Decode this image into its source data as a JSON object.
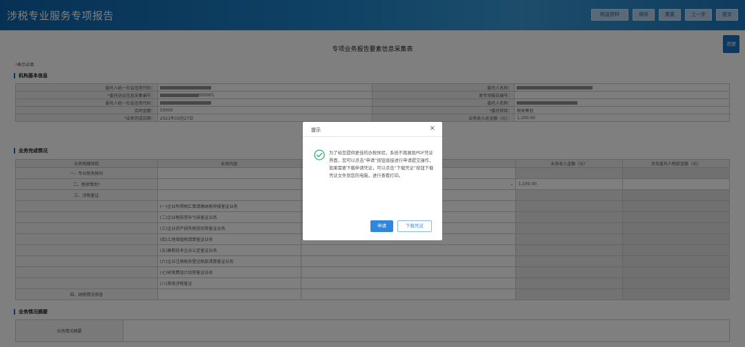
{
  "header": {
    "title": "涉税专业服务专项报告",
    "buttons": [
      "附送资料",
      "保存",
      "重置",
      "上一步",
      "提交"
    ]
  },
  "form": {
    "title": "专项业务报告要素信息采集表",
    "progress_label": "进度",
    "required_note_star": "*",
    "required_note": "表示必填"
  },
  "basic_section": {
    "title": "机构基本信息",
    "rows": [
      {
        "left_label": "委托人统一社会信用代码：",
        "left_value": "",
        "right_label": "委托人名称：",
        "right_value": ""
      },
      {
        "left_label": "委托协议信息采集编号：",
        "left_value": "000001",
        "right_label": "原专项报告编号：",
        "right_value": ""
      },
      {
        "left_label": "委托人统一社会信用代码：",
        "left_value": "",
        "right_label": "委托人名称：",
        "right_value": ""
      },
      {
        "left_label": "合同金额：",
        "left_value": "50000",
        "right_label": "委托项目：",
        "right_value": "税收筹划"
      },
      {
        "left_label": "业务完成日期：",
        "left_value": "2021年03月27日",
        "right_label": "业务收入总金额（元）：",
        "right_value": "1,100.00"
      }
    ]
  },
  "business_section": {
    "title": "业务完成情况",
    "columns": [
      "业务明细项目",
      "业务内容",
      "业务收入金额（元）",
      "涉及委托人税款金额（元）"
    ],
    "items": [
      {
        "item": "一、专业税务顾问",
        "content": "",
        "amount": ""
      },
      {
        "item": "二、税收策划",
        "content": "",
        "amount": "1,100.00"
      },
      {
        "item": "三、涉税鉴证",
        "content": "",
        "amount": ""
      },
      {
        "item": "",
        "content": "(一)企业所得税汇算清缴纳税申报鉴证业务",
        "amount": ""
      },
      {
        "item": "",
        "content": "(二)企业税前弥补亏损鉴证业务",
        "amount": ""
      },
      {
        "item": "",
        "content": "(三)企业资产损失税前扣除鉴证业务",
        "amount": ""
      },
      {
        "item": "",
        "content": "(四)土地增值税清算鉴证业务",
        "amount": ""
      },
      {
        "item": "",
        "content": "(五)高新技术企业认定鉴证业务",
        "amount": ""
      },
      {
        "item": "",
        "content": "(六)企业注销税务登记税款清算鉴证业务",
        "amount": ""
      },
      {
        "item": "",
        "content": "(七)研发费加计扣除鉴证业务",
        "amount": ""
      },
      {
        "item": "",
        "content": "(八)其他涉税鉴证",
        "amount": ""
      },
      {
        "item": "四、纳税情况审查",
        "content": "",
        "amount": ""
      }
    ]
  },
  "summary_section": {
    "title": "业务情况摘要",
    "label": "业务情况摘要"
  },
  "modal": {
    "title": "提示",
    "close": "×",
    "message": "为了给您提供更佳的办税体验，系统不再展现PDF凭证界面，您可以点击“申请”按钮直接进行申请提交操作，如果需要下载申请凭证，可以点击“下载凭证”按钮下载凭证文件到您的电脑，进行查看打印。",
    "apply_label": "申请",
    "download_label": "下载凭证"
  },
  "colors": {
    "header": "#1f84c9",
    "primary": "#2e86de",
    "success": "#2fb86a",
    "required": "#e33333"
  },
  "icons": {
    "modal": "check-circle-icon",
    "close": "close-icon"
  }
}
